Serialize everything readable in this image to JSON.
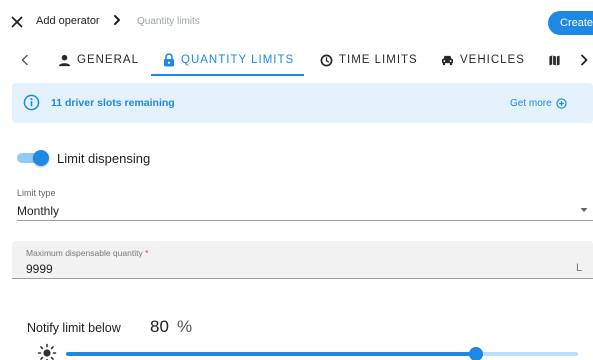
{
  "header": {
    "breadcrumb": [
      "Add operator",
      "Quantity limits"
    ],
    "create_label": "Create"
  },
  "tabs": [
    {
      "label": "GENERAL",
      "icon": "person-icon",
      "active": false
    },
    {
      "label": "QUANTITY LIMITS",
      "icon": "lock-icon",
      "active": true
    },
    {
      "label": "TIME LIMITS",
      "icon": "clock-icon",
      "active": false
    },
    {
      "label": "VEHICLES",
      "icon": "car-icon",
      "active": false
    },
    {
      "label": "",
      "icon": "map-icon",
      "active": false
    }
  ],
  "banner": {
    "text": "11 driver slots remaining",
    "action": "Get more"
  },
  "limit_dispensing": {
    "label": "Limit dispensing",
    "enabled": true
  },
  "limit_type": {
    "label": "Limit type",
    "value": "Monthly"
  },
  "max_quantity": {
    "label": "Maximum dispensable quantity",
    "required_mark": "*",
    "value": "9999",
    "unit": "L"
  },
  "notify": {
    "label": "Notify limit below",
    "value": "80",
    "unit": "%",
    "slider_percent": 80
  },
  "colors": {
    "accent": "#1e88e5",
    "banner_bg": "#e3f2fd",
    "field_bg": "#f2f2f2"
  }
}
